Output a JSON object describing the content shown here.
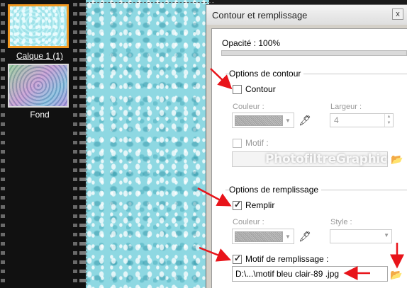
{
  "layers": {
    "items": [
      {
        "label": "Calque 1 (1)"
      },
      {
        "label": "Fond"
      }
    ]
  },
  "dialog": {
    "title": "Contour et remplissage",
    "close_label": "x",
    "opacity": {
      "label": "Opacité : 100%",
      "value": 1.0
    },
    "contour_group": {
      "title": "Options de contour",
      "contour_label": "Contour",
      "contour_checked": false,
      "couleur_label": "Couleur :",
      "largeur_label": "Largeur :",
      "largeur_value": "4",
      "motif_label": "Motif :",
      "motif_checked": false,
      "motif_path": ""
    },
    "remplissage_group": {
      "title": "Options de remplissage",
      "remplir_label": "Remplir",
      "remplir_checked": true,
      "couleur_label": "Couleur :",
      "style_label": "Style :",
      "motif_label": "Motif de remplissage :",
      "motif_checked": true,
      "motif_path": "D:\\...\\motif bleu clair-89 .jpg"
    }
  },
  "watermark": "PhotofiltreGraphic",
  "colors": {
    "annotation_arrow": "#e8141a",
    "selected_border": "#f29a22"
  }
}
